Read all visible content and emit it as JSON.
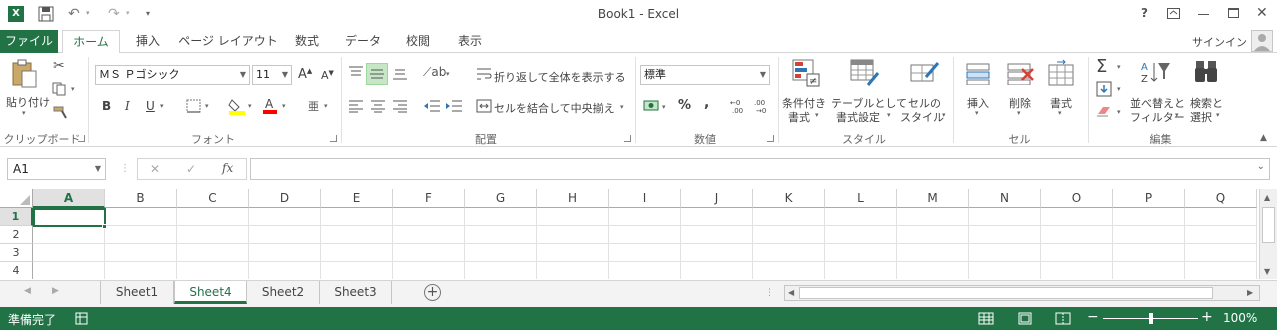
{
  "window": {
    "title": "Book1 - Excel",
    "help": "?"
  },
  "tabs": [
    {
      "label": "ファイル"
    },
    {
      "label": "ホーム"
    },
    {
      "label": "挿入"
    },
    {
      "label": "ページ レイアウト"
    },
    {
      "label": "数式"
    },
    {
      "label": "データ"
    },
    {
      "label": "校閲"
    },
    {
      "label": "表示"
    }
  ],
  "account": {
    "signin": "サインイン"
  },
  "ribbon": {
    "clipboard": {
      "paste": "貼り付け",
      "group": "クリップボード"
    },
    "font": {
      "name": "ＭＳ Ｐゴシック",
      "size": "11",
      "grow": "A",
      "shrink": "A",
      "bold": "B",
      "italic": "I",
      "underline": "U",
      "group": "フォント"
    },
    "alignment": {
      "wrap": "折り返して全体を表示する",
      "merge": "セルを結合して中央揃え",
      "group": "配置"
    },
    "number": {
      "format": "標準",
      "percent": "%",
      "comma": ",",
      "group": "数値"
    },
    "styles": {
      "conditional_1": "条件付き",
      "conditional_2": "書式",
      "table_1": "テーブルとして",
      "table_2": "書式設定",
      "cell_1": "セルの",
      "cell_2": "スタイル",
      "group": "スタイル"
    },
    "cells": {
      "insert": "挿入",
      "delete": "削除",
      "format": "書式",
      "group": "セル"
    },
    "editing": {
      "sort_1": "並べ替えと",
      "sort_2": "フィルター",
      "find_1": "検索と",
      "find_2": "選択",
      "group": "編集"
    }
  },
  "formula_bar": {
    "name_box": "A1",
    "fx": "fx",
    "value": ""
  },
  "grid": {
    "columns": [
      "A",
      "B",
      "C",
      "D",
      "E",
      "F",
      "G",
      "H",
      "I",
      "J",
      "K",
      "L",
      "M",
      "N",
      "O",
      "P",
      "Q"
    ],
    "rows": [
      "1",
      "2",
      "3",
      "4"
    ],
    "selected_cell": "A1"
  },
  "sheets": [
    {
      "name": "Sheet1"
    },
    {
      "name": "Sheet4"
    },
    {
      "name": "Sheet2"
    },
    {
      "name": "Sheet3"
    }
  ],
  "active_sheet": "Sheet4",
  "status": {
    "ready": "準備完了",
    "zoom": "100%",
    "zoom_level": 1.0,
    "minus": "−",
    "plus": "+"
  },
  "colors": {
    "accent": "#217346",
    "border": "#d4d4d4"
  }
}
